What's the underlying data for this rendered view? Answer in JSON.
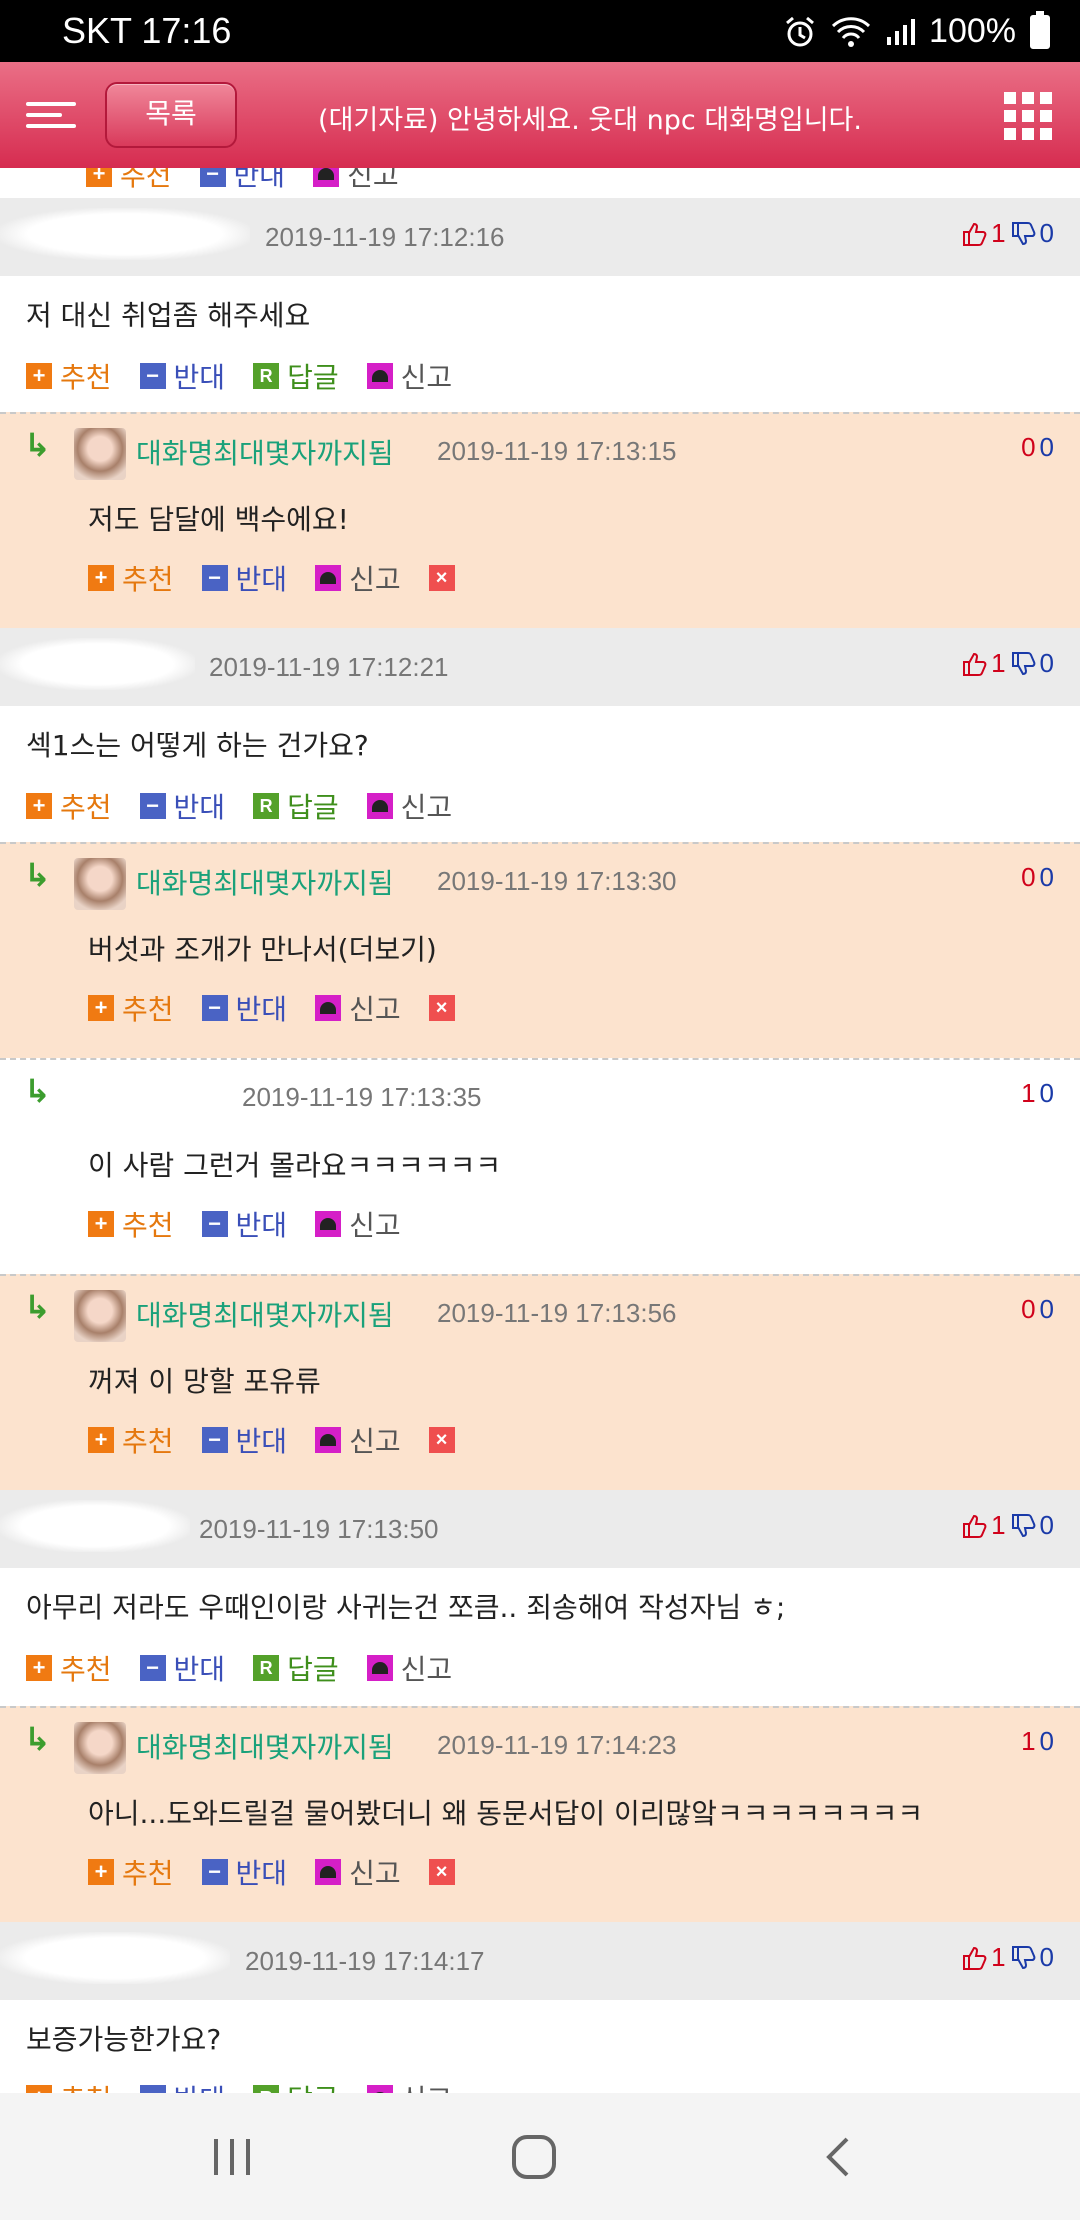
{
  "status_bar": {
    "carrier_time": "SKT 17:16",
    "battery": "100%"
  },
  "header": {
    "list_button": "목록",
    "title": "(대기자료) 안녕하세요. 웃대 npc 대화명입니다."
  },
  "actions": {
    "recommend": "추천",
    "oppose": "반대",
    "reply": "답글",
    "report": "신고"
  },
  "comments": [
    {
      "date": "2019-11-19 17:12:16",
      "up": "1",
      "down": "0",
      "text": "저 대신 취업좀 해주세요"
    },
    {
      "date": "2019-11-19 17:12:21",
      "up": "1",
      "down": "0",
      "text": "섹1스는 어떻게 하는 건가요?"
    },
    {
      "date": "2019-11-19 17:13:50",
      "up": "1",
      "down": "0",
      "text": "아무리 저라도 우때인이랑 사귀는건 쪼큼.. 죄송해여 작성자님 ㅎ;"
    },
    {
      "date": "2019-11-19 17:14:17",
      "up": "1",
      "down": "0",
      "text": "보증가능한가요?"
    }
  ],
  "replies": [
    {
      "nick": "대화명최대몇자까지됨",
      "date": "2019-11-19 17:13:15",
      "up": "0",
      "down": "0",
      "text": "저도 담달에 백수에요!"
    },
    {
      "nick": "대화명최대몇자까지됨",
      "date": "2019-11-19 17:13:30",
      "up": "0",
      "down": "0",
      "text": "버섯과 조개가 만나서(더보기)"
    },
    {
      "nick": "",
      "date": "2019-11-19 17:13:35",
      "up": "1",
      "down": "0",
      "text": "이 사람 그런거 몰라요ㅋㅋㅋㅋㅋㅋ"
    },
    {
      "nick": "대화명최대몇자까지됨",
      "date": "2019-11-19 17:13:56",
      "up": "0",
      "down": "0",
      "text": "꺼져 이 망할 포유류"
    },
    {
      "nick": "대화명최대몇자까지됨",
      "date": "2019-11-19 17:14:23",
      "up": "1",
      "down": "0",
      "text": "아니...도와드릴걸 물어봤더니 왜 동문서답이 이리많앜ㅋㅋㅋㅋㅋㅋㅋㅋ"
    }
  ],
  "colors": {
    "header_top": "#ea6f86",
    "header_bottom": "#d62c50",
    "reply_bg": "#fce3ce",
    "nick": "#1aa17a"
  }
}
